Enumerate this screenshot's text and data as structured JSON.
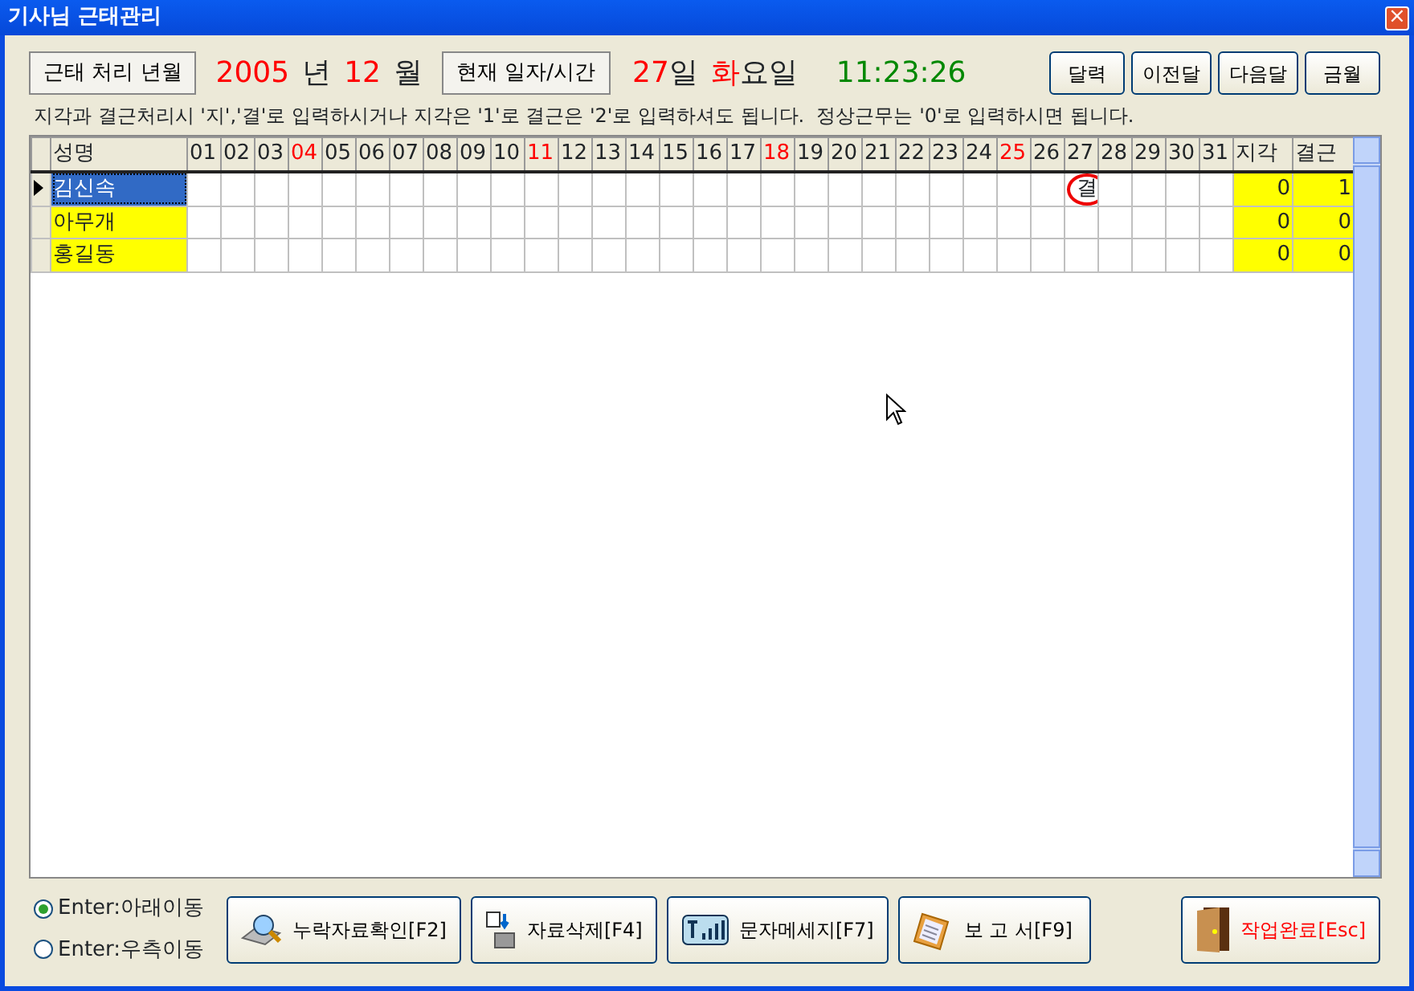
{
  "window": {
    "title": "기사님 근태관리",
    "close": "×"
  },
  "header": {
    "period_button": "근태 처리 년월",
    "year": "2005",
    "year_unit": "년",
    "month": "12",
    "month_unit": "월",
    "now_button": "현재 일자/시간",
    "day": "27",
    "day_unit": "일",
    "weekday": "화",
    "weekday_unit": "요일",
    "time": "11:23:26"
  },
  "nav_buttons": [
    "달력",
    "이전달",
    "다음달",
    "금월"
  ],
  "instructions": "지각과 결근처리시 '지','결'로 입력하시거나 지각은 '1'로 결근은 '2'로 입력하셔도 됩니다.  정상근무는 '0'로 입력하시면 됩니다.",
  "table": {
    "name_column": "성명",
    "days": [
      {
        "label": "01",
        "holiday": false
      },
      {
        "label": "02",
        "holiday": false
      },
      {
        "label": "03",
        "holiday": false
      },
      {
        "label": "04",
        "holiday": true
      },
      {
        "label": "05",
        "holiday": false
      },
      {
        "label": "06",
        "holiday": false
      },
      {
        "label": "07",
        "holiday": false
      },
      {
        "label": "08",
        "holiday": false
      },
      {
        "label": "09",
        "holiday": false
      },
      {
        "label": "10",
        "holiday": false
      },
      {
        "label": "11",
        "holiday": true
      },
      {
        "label": "12",
        "holiday": false
      },
      {
        "label": "13",
        "holiday": false
      },
      {
        "label": "14",
        "holiday": false
      },
      {
        "label": "15",
        "holiday": false
      },
      {
        "label": "16",
        "holiday": false
      },
      {
        "label": "17",
        "holiday": false
      },
      {
        "label": "18",
        "holiday": true
      },
      {
        "label": "19",
        "holiday": false
      },
      {
        "label": "20",
        "holiday": false
      },
      {
        "label": "21",
        "holiday": false
      },
      {
        "label": "22",
        "holiday": false
      },
      {
        "label": "23",
        "holiday": false
      },
      {
        "label": "24",
        "holiday": false
      },
      {
        "label": "25",
        "holiday": true
      },
      {
        "label": "26",
        "holiday": false
      },
      {
        "label": "27",
        "holiday": false
      },
      {
        "label": "28",
        "holiday": false
      },
      {
        "label": "29",
        "holiday": false
      },
      {
        "label": "30",
        "holiday": false
      },
      {
        "label": "31",
        "holiday": false
      }
    ],
    "late_column": "지각",
    "absent_column": "결근",
    "rows": [
      {
        "name": "김신속",
        "selected": true,
        "cells": [
          null,
          null,
          null,
          null,
          null,
          null,
          null,
          null,
          null,
          null,
          null,
          null,
          null,
          null,
          null,
          null,
          null,
          null,
          null,
          null,
          null,
          null,
          null,
          null,
          null,
          null,
          {
            "text": "결",
            "circled": true
          },
          null,
          null,
          null,
          null
        ],
        "late": "0",
        "absent": "1"
      },
      {
        "name": "아무개",
        "selected": false,
        "cells": [],
        "late": "0",
        "absent": "0"
      },
      {
        "name": "홍길동",
        "selected": false,
        "cells": [],
        "late": "0",
        "absent": "0"
      }
    ]
  },
  "enter_options": [
    {
      "label": "Enter:아래이동",
      "selected": true
    },
    {
      "label": "Enter:우측이동",
      "selected": false
    }
  ],
  "actions": [
    {
      "label": "누락자료확인[F2]",
      "kind": "search"
    },
    {
      "label": "자료삭제[F4]",
      "kind": "delete"
    },
    {
      "label": "문자메세지[F7]",
      "kind": "message"
    },
    {
      "label": "보 고 서[F9]",
      "kind": "report"
    },
    {
      "label": "작업완료[Esc]",
      "kind": "exit"
    }
  ]
}
